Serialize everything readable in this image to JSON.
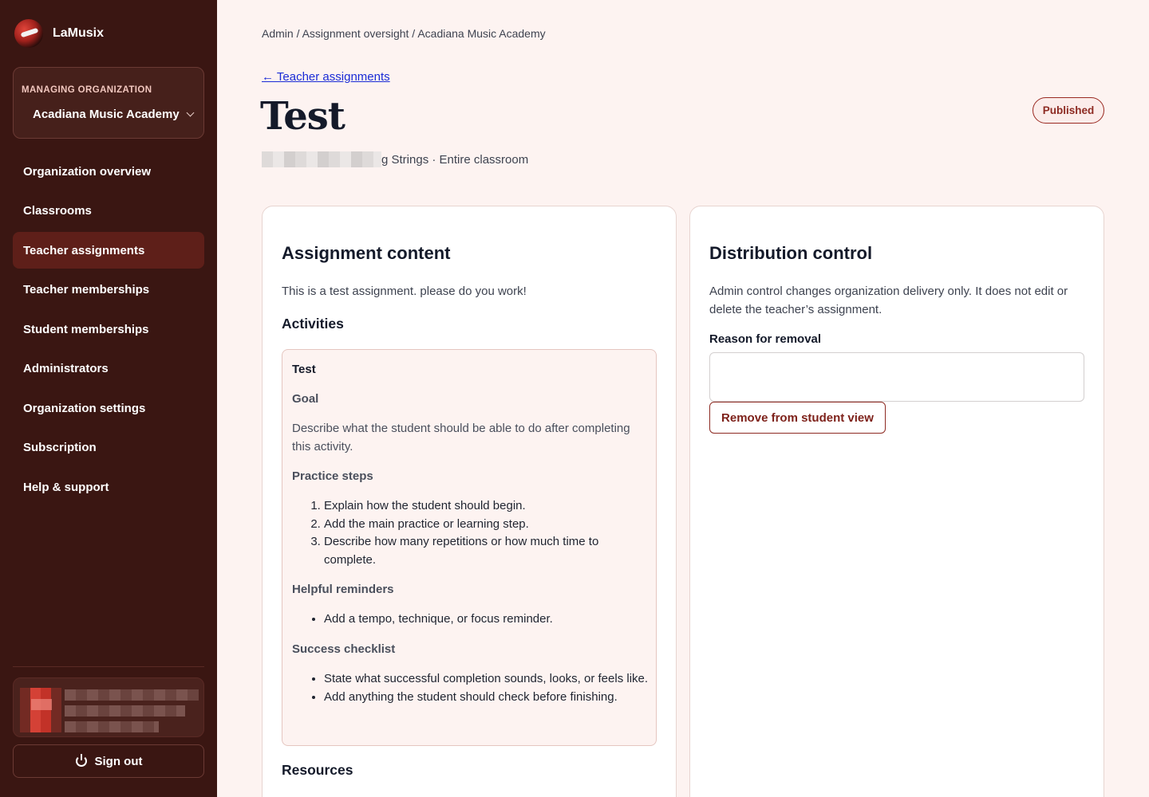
{
  "app": {
    "name": "LaMusix",
    "logo_icon": "lamusix-logo-icon"
  },
  "org": {
    "label": "MANAGING ORGANIZATION",
    "selected": "Acadiana Music Academy"
  },
  "nav": {
    "items": [
      {
        "label": "Organization overview"
      },
      {
        "label": "Classrooms"
      },
      {
        "label": "Teacher assignments",
        "active": true
      },
      {
        "label": "Teacher memberships"
      },
      {
        "label": "Student memberships"
      },
      {
        "label": "Administrators"
      },
      {
        "label": "Organization settings"
      },
      {
        "label": "Subscription"
      },
      {
        "label": "Help & support"
      }
    ]
  },
  "user": {
    "signout_label": "Sign out"
  },
  "breadcrumb": "Admin / Assignment oversight / Acadiana Music Academy",
  "back_link": "← Teacher assignments",
  "page": {
    "title": "Test",
    "status": "Published",
    "subtitle_visible": "g Strings · Entire classroom"
  },
  "content": {
    "heading": "Assignment content",
    "description": "This is a test assignment. please do you work!",
    "activities_heading": "Activities",
    "activity": {
      "title": "Test",
      "goal_heading": "Goal",
      "goal_text": "Describe what the student should be able to do after completing this activity.",
      "steps_heading": "Practice steps",
      "steps": [
        "Explain how the student should begin.",
        "Add the main practice or learning step.",
        "Describe how many repetitions or how much time to complete."
      ],
      "reminders_heading": "Helpful reminders",
      "reminders": [
        "Add a tempo, technique, or focus reminder."
      ],
      "checklist_heading": "Success checklist",
      "checklist": [
        "State what successful completion sounds, looks, or feels like.",
        "Add anything the student should check before finishing."
      ]
    },
    "resources_heading": "Resources"
  },
  "distribution": {
    "heading": "Distribution control",
    "description": "Admin control changes organization delivery only. It does not edit or delete the teacher’s assignment.",
    "reason_label": "Reason for removal",
    "reason_value": "",
    "remove_button": "Remove from student view"
  },
  "colors": {
    "sidebar": "#3a1612",
    "accent": "#8d2a22",
    "background": "#fdf3f1"
  }
}
